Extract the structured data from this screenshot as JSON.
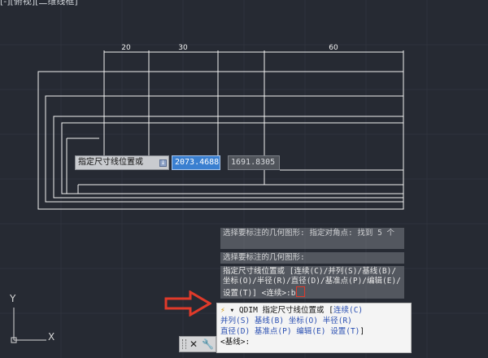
{
  "viewport": {
    "label": "[-][俯视][二维线框]"
  },
  "drawing": {
    "dimensions": [
      "20",
      "30",
      "60"
    ]
  },
  "dynamic_input": {
    "prompt": "指定尺寸线位置或",
    "value1": "2073.4688",
    "value2": "1691.8305"
  },
  "command_history": {
    "line1": "选择要标注的几何图形: 指定对角点: 找到 5 个",
    "line2": "选择要标注的几何图形:",
    "line3": "指定尺寸线位置或 [连续(C)/并列(S)/基线(B)/坐标(O)/半径(R)/直径(D)/基准点(P)/编辑(E)/设置(T)] <连续>:b"
  },
  "command_prompt": {
    "command": "QDIM 指定尺寸线位置或",
    "opt_continuous": "连续(C)",
    "opt_stagger": "并列(S)",
    "opt_baseline": "基线(B)",
    "opt_ordinate": "坐标(O)",
    "opt_radius": "半径(R)",
    "opt_diameter": "直径(D)",
    "opt_datum": "基准点(P)",
    "opt_edit": "编辑(E)",
    "opt_settings": "设置(T)",
    "default": "<基线>:"
  },
  "ucs": {
    "y_label": "Y",
    "x_label": "X"
  },
  "colors": {
    "background": "#262a33",
    "lines": "#f2f2f2",
    "highlight": "#3a7fd0",
    "arrow": "#e03a2a",
    "keyword": "#2a4fb2"
  },
  "icons": {
    "close": "close-icon",
    "customize": "wrench-icon",
    "prompt_bolt": "lightning-icon"
  }
}
